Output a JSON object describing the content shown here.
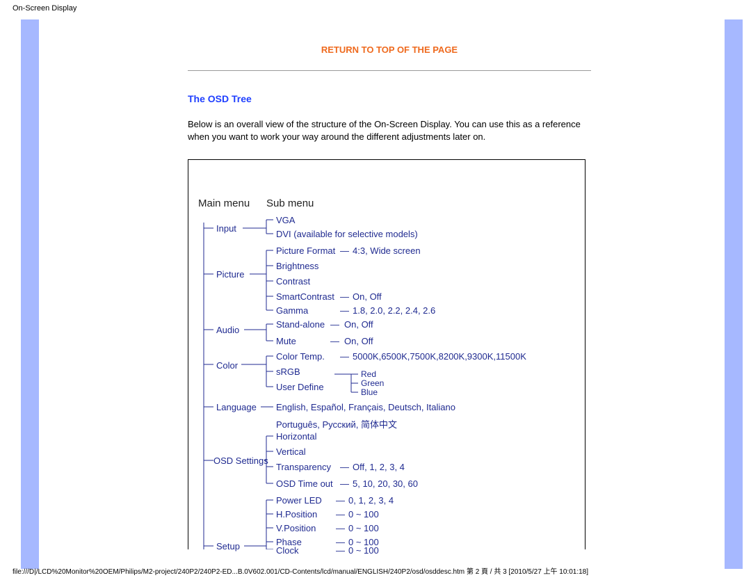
{
  "header": {
    "title": "On-Screen Display"
  },
  "links": {
    "return_top": "RETURN TO TOP OF THE PAGE"
  },
  "section": {
    "heading": "The OSD Tree",
    "intro": "Below is an overall view of the structure of the On-Screen Display. You can use this as a reference when you want to work your way around the different adjustments later on."
  },
  "diagram": {
    "main_menu_label": "Main menu",
    "sub_menu_label": "Sub menu",
    "main": {
      "input": "Input",
      "picture": "Picture",
      "audio": "Audio",
      "color": "Color",
      "language": "Language",
      "osd_settings": "OSD Settings",
      "setup": "Setup"
    },
    "sub": {
      "vga": "VGA",
      "dvi": "DVI (available for selective models)",
      "picture_format": "Picture Format",
      "picture_format_vals": "4:3, Wide screen",
      "brightness": "Brightness",
      "contrast": "Contrast",
      "smart_contrast": "SmartContrast",
      "smart_contrast_vals": "On, Off",
      "gamma": "Gamma",
      "gamma_vals": "1.8, 2.0, 2.2, 2.4, 2.6",
      "stand_alone": "Stand-alone",
      "stand_alone_vals": "On, Off",
      "mute": "Mute",
      "mute_vals": "On, Off",
      "color_temp": "Color Temp.",
      "color_temp_vals": "5000K,6500K,7500K,8200K,9300K,11500K",
      "srgb": "sRGB",
      "user_define": "User Define",
      "red": "Red",
      "green": "Green",
      "blue": "Blue",
      "language_vals1": "English, Español, Français, Deutsch, Italiano",
      "language_vals2": "Português, Русский, 简体中文",
      "horizontal": "Horizontal",
      "vertical": "Vertical",
      "transparency": "Transparency",
      "transparency_vals": "Off, 1, 2, 3, 4",
      "osd_timeout": "OSD Time out",
      "osd_timeout_vals": "5, 10, 20, 30, 60",
      "power_led": "Power LED",
      "power_led_vals": "0, 1, 2, 3, 4",
      "hpos": "H.Position",
      "hpos_vals": "0 ~ 100",
      "vpos": "V.Position",
      "vpos_vals": "0 ~ 100",
      "phase": "Phase",
      "phase_vals": "0 ~ 100",
      "clock": "Clock",
      "clock_vals": "0 ~ 100"
    }
  },
  "footer": {
    "path": "file:///D|/LCD%20Monitor%20OEM/Philips/M2-project/240P2/240P2-ED...B.0V602.001/CD-Contents/lcd/manual/ENGLISH/240P2/osd/osddesc.htm 第 2 頁 / 共 3  [2010/5/27 上午 10:01:18]"
  }
}
